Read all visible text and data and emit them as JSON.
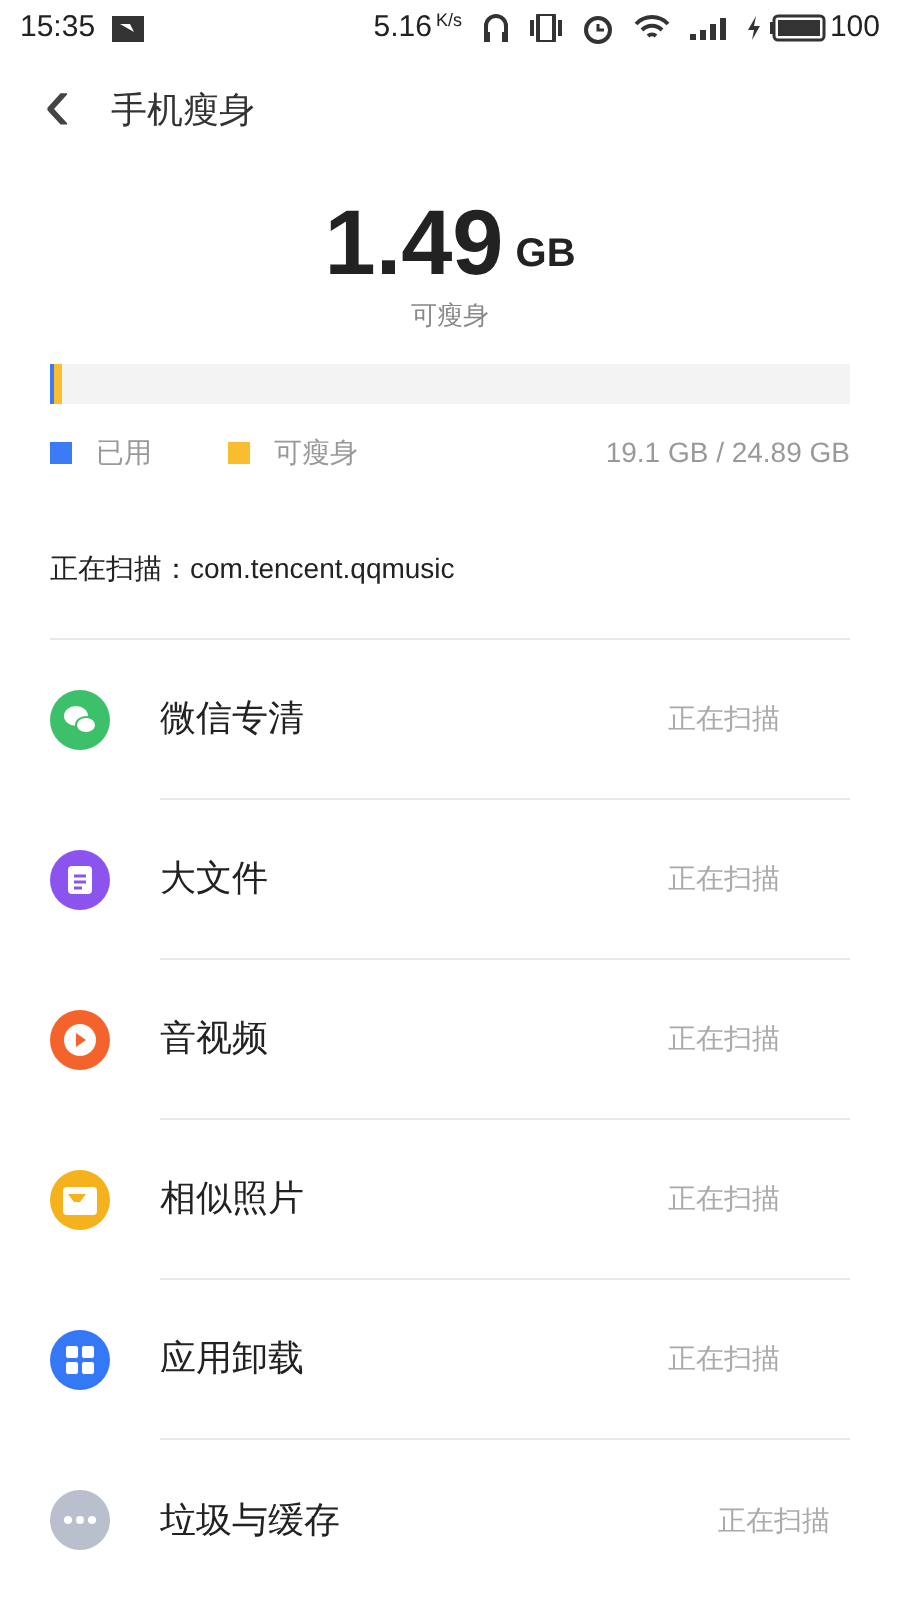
{
  "status_bar": {
    "time": "15:35",
    "speed": "5.16",
    "speed_unit": "K/s",
    "battery": "100"
  },
  "header": {
    "back": "‹",
    "title": "手机瘦身"
  },
  "summary": {
    "value": "1.49",
    "unit": "GB",
    "caption": "可瘦身"
  },
  "storage": {
    "segments": [
      {
        "label": "已用",
        "color": "#3b7bf6",
        "level": 0.005
      },
      {
        "label": "可瘦身",
        "color": "#f8be2f",
        "level": 0.01
      }
    ],
    "total": "19.1 GB / 24.89 GB"
  },
  "scanning": "正在扫描：com.tencent.qqmusic",
  "items": [
    {
      "kind": "wechat",
      "color": "#3cc06a",
      "title": "微信专清",
      "status": "正在扫描"
    },
    {
      "kind": "file",
      "color": "#8c54ee",
      "title": "大文件",
      "status": "正在扫描"
    },
    {
      "kind": "video",
      "color": "#f4632c",
      "title": "音视频",
      "status": "正在扫描"
    },
    {
      "kind": "photo",
      "color": "#f6b21d",
      "title": "相似照片",
      "status": "正在扫描"
    },
    {
      "kind": "apps",
      "color": "#3478f6",
      "title": "应用卸载",
      "status": "正在扫描"
    },
    {
      "kind": "more",
      "color": "#b9bfcc",
      "title": "垃圾与缓存",
      "status": "正在扫描"
    }
  ]
}
